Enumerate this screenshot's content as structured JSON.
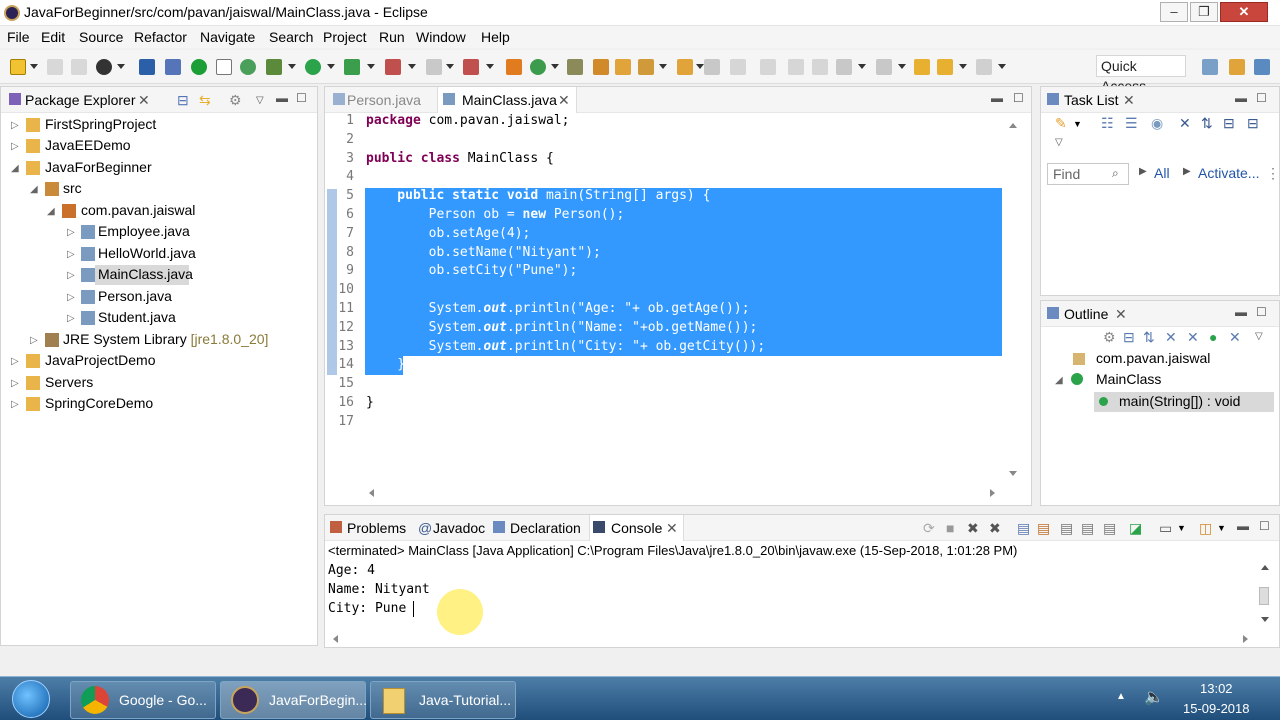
{
  "window": {
    "title": "JavaForBeginner/src/com/pavan/jaiswal/MainClass.java - Eclipse"
  },
  "menu": [
    "File",
    "Edit",
    "Source",
    "Refactor",
    "Navigate",
    "Search",
    "Project",
    "Run",
    "Window",
    "Help"
  ],
  "toolbar": {
    "quick_access": "Quick Access"
  },
  "package_explorer": {
    "title": "Package Explorer",
    "items": [
      {
        "label": "FirstSpringProject"
      },
      {
        "label": "JavaEEDemo"
      },
      {
        "label": "JavaForBeginner"
      },
      {
        "label": "src"
      },
      {
        "label": "com.pavan.jaiswal"
      },
      {
        "label": "Employee.java"
      },
      {
        "label": "HelloWorld.java"
      },
      {
        "label": "MainClass.java"
      },
      {
        "label": "Person.java"
      },
      {
        "label": "Student.java"
      },
      {
        "label": "JRE System Library",
        "extra": "[jre1.8.0_20]"
      },
      {
        "label": "JavaProjectDemo"
      },
      {
        "label": "Servers"
      },
      {
        "label": "SpringCoreDemo"
      }
    ]
  },
  "editor": {
    "tabs": [
      "Person.java",
      "MainClass.java"
    ],
    "lines": [
      {
        "n": "1",
        "parts": [
          {
            "t": "package",
            "k": 1
          },
          {
            "t": " com.pavan.jaiswal;"
          }
        ]
      },
      {
        "n": "2",
        "parts": []
      },
      {
        "n": "3",
        "parts": [
          {
            "t": "public",
            "k": 1
          },
          {
            "t": " "
          },
          {
            "t": "class",
            "k": 1
          },
          {
            "t": " MainClass {"
          }
        ]
      },
      {
        "n": "4",
        "parts": []
      },
      {
        "n": "5",
        "parts": [
          {
            "t": "    public",
            "k": 1
          },
          {
            "t": " "
          },
          {
            "t": "static",
            "k": 1
          },
          {
            "t": " "
          },
          {
            "t": "void",
            "k": 1
          },
          {
            "t": " main(String[] args) {"
          }
        ]
      },
      {
        "n": "6",
        "parts": [
          {
            "t": "        Person ob = "
          },
          {
            "t": "new",
            "k": 1
          },
          {
            "t": " Person();"
          }
        ]
      },
      {
        "n": "7",
        "parts": [
          {
            "t": "        ob.setAge(4);"
          }
        ]
      },
      {
        "n": "8",
        "parts": [
          {
            "t": "        ob.setName(\"Nityant\");"
          }
        ]
      },
      {
        "n": "9",
        "parts": [
          {
            "t": "        ob.setCity(\"Pune\");"
          }
        ]
      },
      {
        "n": "10",
        "parts": []
      },
      {
        "n": "11",
        "parts": [
          {
            "t": "        System."
          },
          {
            "t": "out",
            "i": 1
          },
          {
            "t": ".println(\"Age: \"+ ob.getAge());"
          }
        ]
      },
      {
        "n": "12",
        "parts": [
          {
            "t": "        System."
          },
          {
            "t": "out",
            "i": 1
          },
          {
            "t": ".println(\"Name: \"+ob.getName());"
          }
        ]
      },
      {
        "n": "13",
        "parts": [
          {
            "t": "        System."
          },
          {
            "t": "out",
            "i": 1
          },
          {
            "t": ".println(\"City: \"+ ob.getCity());"
          }
        ]
      },
      {
        "n": "14",
        "parts": [
          {
            "t": "    }"
          }
        ]
      },
      {
        "n": "15",
        "parts": []
      },
      {
        "n": "16",
        "parts": [
          {
            "t": "}"
          }
        ]
      },
      {
        "n": "17",
        "parts": []
      }
    ]
  },
  "task_list": {
    "title": "Task List",
    "find_placeholder": "Find",
    "all": "All",
    "activate": "Activate..."
  },
  "outline": {
    "title": "Outline",
    "items": [
      "com.pavan.jaiswal",
      "MainClass",
      "main(String[]) : void"
    ]
  },
  "console": {
    "tabs": [
      "Problems",
      "Javadoc",
      "Declaration",
      "Console"
    ],
    "status": "<terminated> MainClass [Java Application] C:\\Program Files\\Java\\jre1.8.0_20\\bin\\javaw.exe (15-Sep-2018, 1:01:28 PM)",
    "output": [
      "Age: 4",
      "Name: Nityant",
      "City: Pune"
    ]
  },
  "taskbar": {
    "tasks": [
      "Google - Go...",
      "JavaForBegin...",
      "Java-Tutorial..."
    ],
    "time": "13:02",
    "date": "15-09-2018"
  }
}
